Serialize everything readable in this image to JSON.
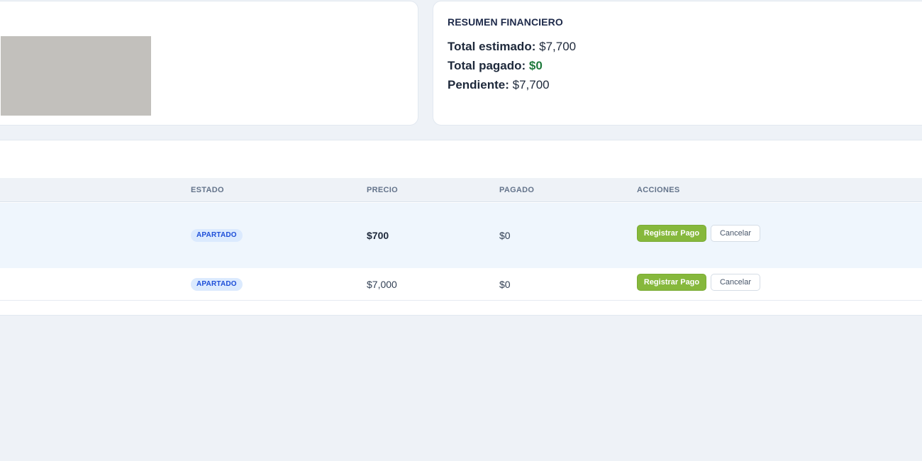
{
  "summary": {
    "title": "RESUMEN FINANCIERO",
    "total_estimated_label": "Total estimado:",
    "total_estimated_value": "$7,700",
    "total_paid_label": "Total pagado:",
    "total_paid_value": "$0",
    "pending_label": "Pendiente:",
    "pending_value": "$7,700",
    "paid_color": "#1f7a3d"
  },
  "table": {
    "headers": {
      "estado": "ESTADO",
      "precio": "PRECIO",
      "pagado": "PAGADO",
      "acciones": "ACCIONES"
    },
    "rows": [
      {
        "status": "APARTADO",
        "price": "$700",
        "paid": "$0",
        "pay_label": "Registrar Pago",
        "cancel_label": "Cancelar"
      },
      {
        "status": "APARTADO",
        "price": "$7,000",
        "paid": "$0",
        "pay_label": "Registrar Pago",
        "cancel_label": "Cancelar"
      }
    ]
  },
  "colors": {
    "accent_green": "#86b83c",
    "badge_bg": "#dbeafe",
    "badge_text": "#1d4ed8",
    "page_bg": "#eef2f7"
  }
}
